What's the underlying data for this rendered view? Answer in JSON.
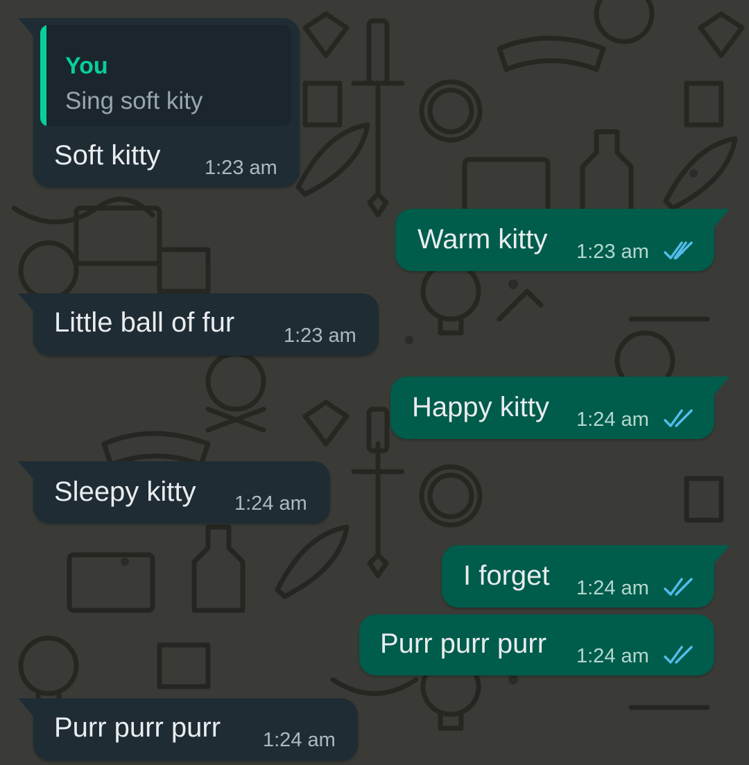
{
  "chat": {
    "messages": [
      {
        "direction": "incoming",
        "text": "Soft kitty",
        "time": "1:23 am",
        "reply_to": {
          "author": "You",
          "text": "Sing soft kity"
        }
      },
      {
        "direction": "outgoing",
        "text": "Warm kitty",
        "time": "1:23 am",
        "status": "read"
      },
      {
        "direction": "incoming",
        "text": "Little ball of fur",
        "time": "1:23 am"
      },
      {
        "direction": "outgoing",
        "text": "Happy kitty",
        "time": "1:24 am",
        "status": "read"
      },
      {
        "direction": "incoming",
        "text": "Sleepy kitty",
        "time": "1:24 am"
      },
      {
        "direction": "outgoing",
        "text": "I forget",
        "time": "1:24 am",
        "status": "read"
      },
      {
        "direction": "outgoing",
        "text": "Purr purr purr",
        "time": "1:24 am",
        "status": "read"
      },
      {
        "direction": "incoming",
        "text": "Purr purr purr",
        "time": "1:24 am"
      }
    ]
  },
  "colors": {
    "incoming_bubble": "#1f2c34",
    "outgoing_bubble": "#005c4b",
    "reply_accent": "#06cf9c",
    "read_ticks": "#53bdeb",
    "wallpaper": "#3a3b37"
  },
  "icons": {
    "read_receipt": "double-check-icon"
  }
}
